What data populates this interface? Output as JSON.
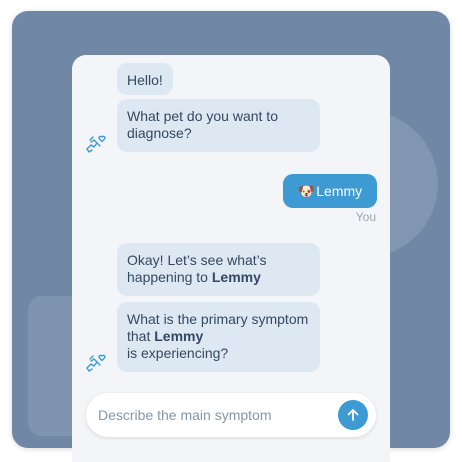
{
  "chat": {
    "messages": [
      {
        "from": "bot",
        "text": "Hello!"
      },
      {
        "from": "bot",
        "text": "What pet do you want to diagnose?"
      },
      {
        "from": "user",
        "emoji": "🐶",
        "text": "Lemmy",
        "sender_label": "You"
      },
      {
        "from": "bot",
        "parts": [
          "Okay! Let’s see what’s happening to ",
          "Lemmy"
        ]
      },
      {
        "from": "bot",
        "parts": [
          "What is the primary symptom that ",
          "Lemmy",
          " is experiencing?"
        ]
      }
    ],
    "bot_icon": "pet-doctor-icon"
  },
  "input": {
    "placeholder": "Describe the main symptom",
    "send_icon": "arrow-up-icon"
  },
  "colors": {
    "backdrop": "#7088a6",
    "bot_bubble": "#dde8f3",
    "user_bubble": "#3d9ad3",
    "accent": "#3d9ad3"
  }
}
